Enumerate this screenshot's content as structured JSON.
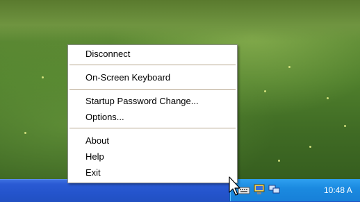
{
  "context_menu": {
    "items": [
      {
        "label": "Disconnect"
      },
      {
        "label": "On-Screen Keyboard"
      },
      {
        "label": "Startup Password Change..."
      },
      {
        "label": "Options..."
      },
      {
        "label": "About"
      },
      {
        "label": "Help"
      },
      {
        "label": "Exit"
      }
    ]
  },
  "taskbar": {
    "clock": "10:48 A",
    "tray_icons": [
      "keyboard-icon",
      "monitor-icon",
      "network-icon"
    ]
  },
  "colors": {
    "taskbar_blue": "#2454cc",
    "tray_blue": "#1b8ae0",
    "separator": "#b5a58c"
  }
}
